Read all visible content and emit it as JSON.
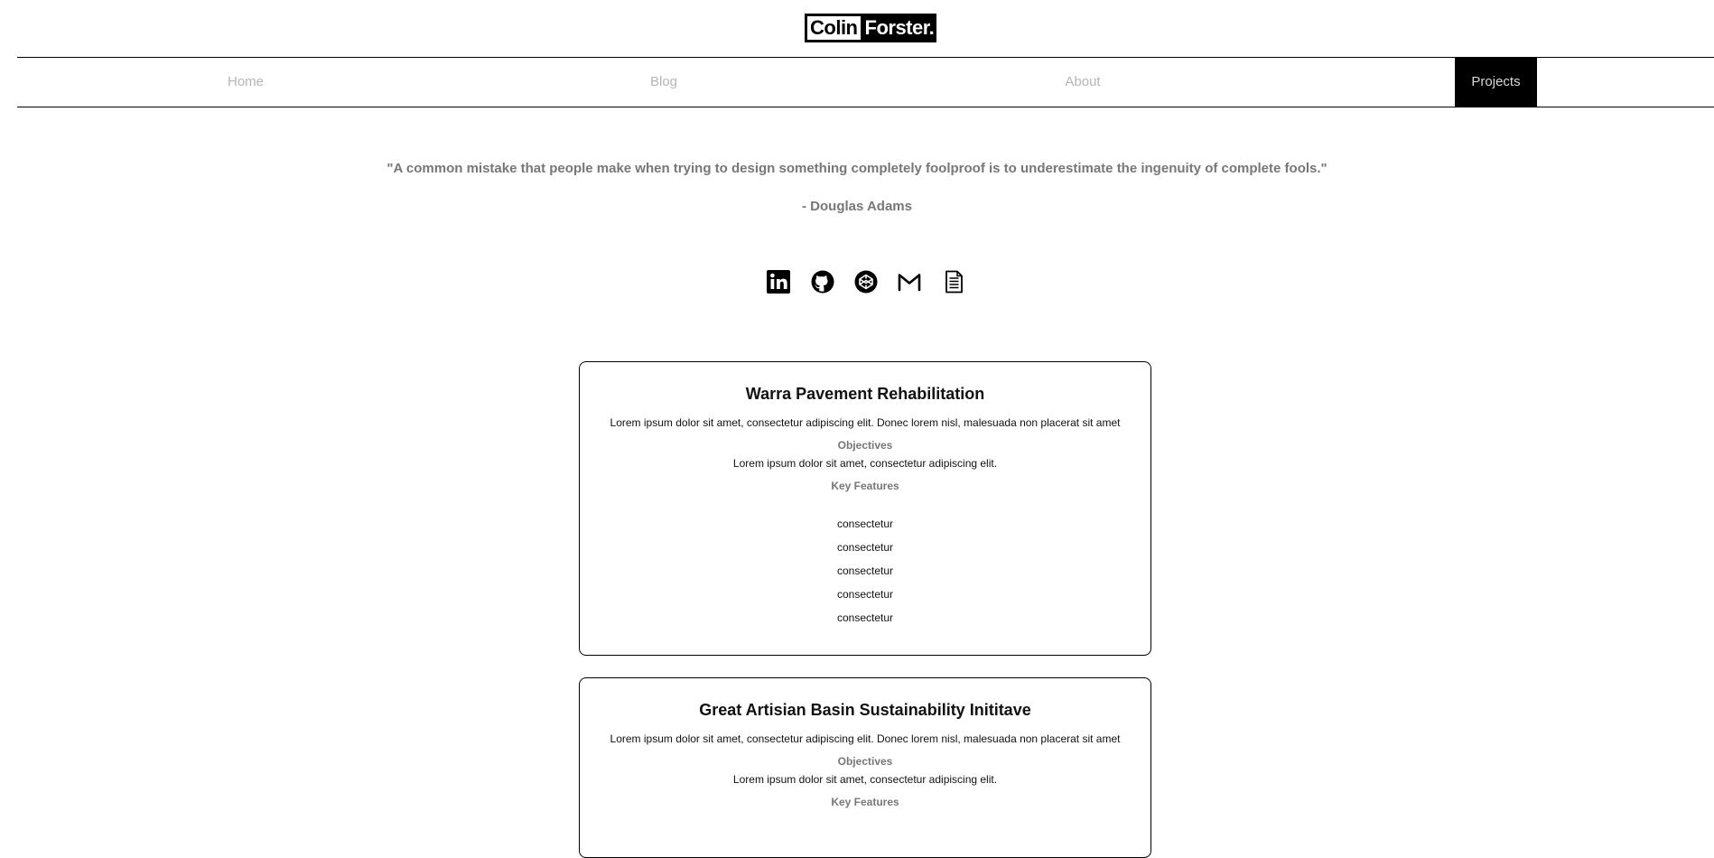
{
  "logo": {
    "first": "Colin",
    "last": "Forster."
  },
  "nav": {
    "items": [
      {
        "label": "Home"
      },
      {
        "label": "Blog"
      },
      {
        "label": "About"
      },
      {
        "label": "Projects",
        "active": true
      }
    ]
  },
  "quote": {
    "text": "\"A common mistake that people make when trying to design something completely foolproof is to underestimate the ingenuity of complete fools.\"",
    "author": "- Douglas Adams"
  },
  "social": [
    {
      "icon": "linkedin-icon"
    },
    {
      "icon": "github-icon"
    },
    {
      "icon": "codepen-icon"
    },
    {
      "icon": "gmail-icon"
    },
    {
      "icon": "resume-icon"
    }
  ],
  "projects": [
    {
      "title": "Warra Pavement Rehabilitation",
      "description": "Lorem ipsum dolor sit amet, consectetur adipiscing elit. Donec lorem nisl, malesuada non placerat sit amet",
      "objectives_label": "Objectives",
      "objectives": "Lorem ipsum dolor sit amet, consectetur adipiscing elit.",
      "features_label": "Key Features",
      "features": [
        "consectetur",
        "consectetur",
        "consectetur",
        "consectetur",
        "consectetur"
      ]
    },
    {
      "title": "Great Artisian Basin Sustainability Inititave",
      "description": "Lorem ipsum dolor sit amet, consectetur adipiscing elit. Donec lorem nisl, malesuada non placerat sit amet",
      "objectives_label": "Objectives",
      "objectives": "Lorem ipsum dolor sit amet, consectetur adipiscing elit.",
      "features_label": "Key Features"
    }
  ],
  "colors": {
    "text": "#111111",
    "muted": "#777777",
    "nav_inactive": "#b5b5b5",
    "accent": "#000000"
  }
}
